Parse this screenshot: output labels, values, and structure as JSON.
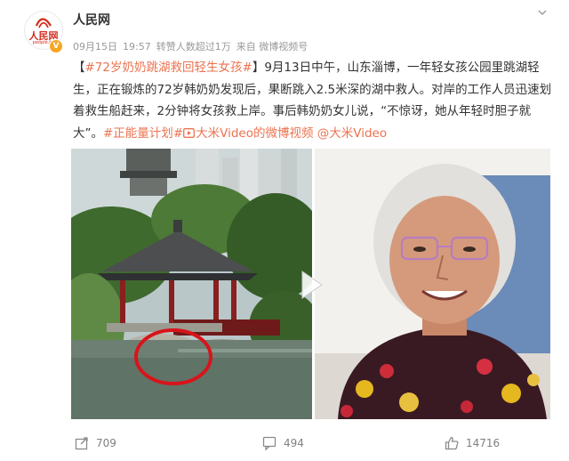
{
  "account": {
    "name": "人民网",
    "avatar_text": "人民网",
    "avatar_subtext": "people.cn",
    "verified_badge": "V",
    "brand_color": "#d52b1e"
  },
  "meta": {
    "date": "09月15日",
    "time": "19:57",
    "likes_summary": "转赞人数超过1万",
    "source": "来自 微博视频号"
  },
  "post": {
    "bracket_open": "【",
    "hashtag": "#72岁奶奶跳湖救回轻生女孩#",
    "bracket_close": "】",
    "body": "9月13日中午，山东淄博，一年轻女孩公园里跳湖轻生，正在锻炼的72岁韩奶奶发现后，果断跳入2.5米深的湖中救人。对岸的工作人员迅速划着救生船赶来，2分钟将女孩救上岸。事后韩奶奶女儿说，“不惊讶，她从年轻时胆子就大”。",
    "tag_positive": "#正能量计划#",
    "video_link": "大米Video的微博视频",
    "mention": "@大米Video",
    "link_color": "#eb7350"
  },
  "media": {
    "left_scene": "lake-pavilion-rescue",
    "right_scene": "elderly-woman-portrait",
    "play_icon": "play-icon"
  },
  "actions": {
    "repost_count": "709",
    "comment_count": "494",
    "like_count": "14716",
    "icons": [
      "share-icon",
      "comment-icon",
      "like-icon"
    ]
  }
}
